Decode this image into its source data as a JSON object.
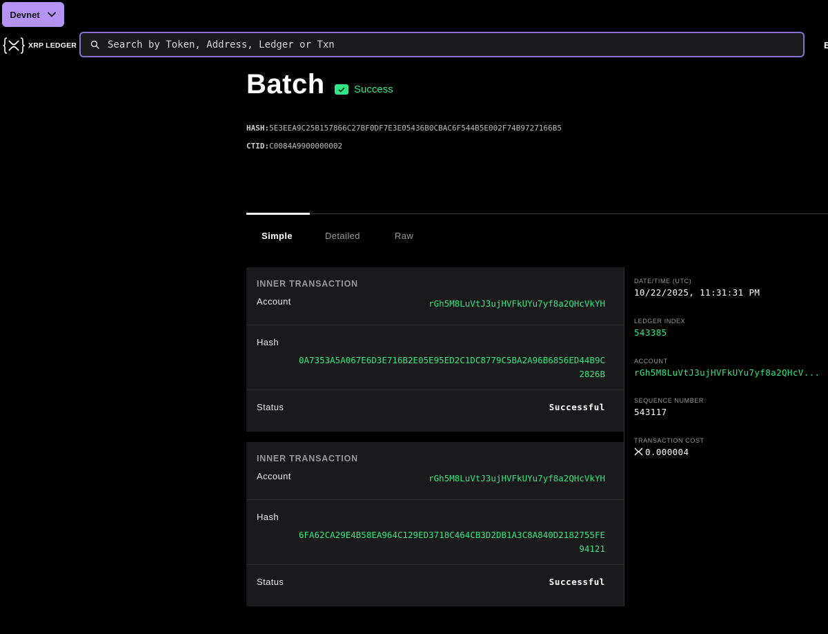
{
  "header": {
    "network_label": "Devnet",
    "logo_text": "XRP LEDGER",
    "search_placeholder": "Search by Token, Address, Ledger or Txn",
    "edge_text": "E"
  },
  "transaction": {
    "type": "Batch",
    "status": "Success",
    "hash_label": "HASH:",
    "hash": "5E3EEA9C25B157866C27BF0DF7E3E05436B0CBAC6F544B5E002F74B9727166B5",
    "ctid_label": "CTID:",
    "ctid": "C0084A9900000002"
  },
  "tabs": [
    {
      "label": "Simple",
      "active": true
    },
    {
      "label": "Detailed",
      "active": false
    },
    {
      "label": "Raw",
      "active": false
    }
  ],
  "inner_transactions": [
    {
      "heading": "INNER TRANSACTION",
      "account_label": "Account",
      "account": "rGh5M8LuVtJ3ujHVFkUYu7yf8a2QHcVkYH",
      "hash_label": "Hash",
      "hash_line1": "0A7353A5A067E6D3E716B2E05E95ED2C1DC8779C5BA2A96B6856ED44B9C",
      "hash_line2": "2826B",
      "status_label": "Status",
      "status": "Successful"
    },
    {
      "heading": "INNER TRANSACTION",
      "account_label": "Account",
      "account": "rGh5M8LuVtJ3ujHVFkUYu7yf8a2QHcVkYH",
      "hash_label": "Hash",
      "hash_line1": "6FA62CA29E4B58EA964C129ED3718C464CB3D2DB1A3C8A840D2182755FE",
      "hash_line2": "94121",
      "status_label": "Status",
      "status": "Successful"
    }
  ],
  "details": {
    "datetime_label": "DATE/TIME (UTC)",
    "datetime": "10/22/2025, 11:31:31 PM",
    "ledger_index_label": "LEDGER INDEX",
    "ledger_index": "543385",
    "account_label": "ACCOUNT",
    "account": "rGh5M8LuVtJ3ujHVFkUYu7yf8a2QHcV...",
    "sequence_label": "SEQUENCE NUMBER",
    "sequence": "543117",
    "cost_label": "TRANSACTION COST",
    "cost": "0.000004"
  },
  "colors": {
    "accent_purple": "#b493f4",
    "success_green": "#32e685",
    "card_bg": "#1a1a1d"
  }
}
